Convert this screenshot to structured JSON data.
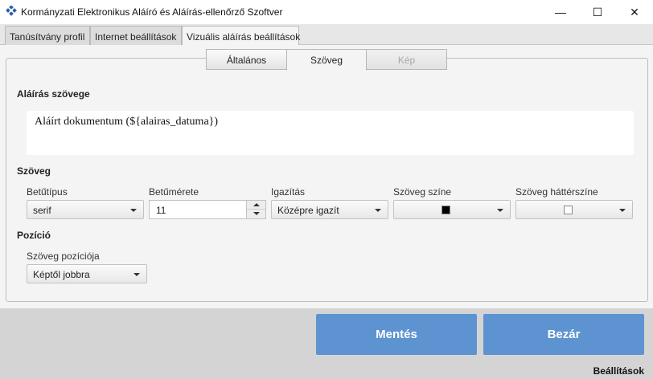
{
  "window": {
    "title": "Kormányzati Elektronikus Aláíró és Aláírás-ellenőrző Szoftver",
    "minimize": "—",
    "maximize": "☐",
    "close": "✕"
  },
  "tabs": [
    {
      "label": "Tanúsítvány profil",
      "active": false
    },
    {
      "label": "Internet beállítások",
      "active": false
    },
    {
      "label": "Vizuális aláírás beállítások",
      "active": true
    }
  ],
  "subtabs": [
    {
      "label": "Általános",
      "state": "normal"
    },
    {
      "label": "Szöveg",
      "state": "active"
    },
    {
      "label": "Kép",
      "state": "disabled"
    }
  ],
  "signature_text": {
    "heading": "Aláírás szövege",
    "value": "Aláírt dokumentum (${alairas_datuma})"
  },
  "text_section": {
    "heading": "Szöveg",
    "font_label": "Betűtípus",
    "font_value": "serif",
    "size_label": "Betűmérete",
    "size_value": "11",
    "align_label": "Igazítás",
    "align_value": "Középre igazít",
    "color_label": "Szöveg színe",
    "color_value": "#000000",
    "bg_label": "Szöveg háttérszíne",
    "bg_value": "#ffffff"
  },
  "position_section": {
    "heading": "Pozíció",
    "pos_label": "Szöveg pozíciója",
    "pos_value": "Képtől jobbra"
  },
  "buttons": {
    "save": "Mentés",
    "close": "Bezár"
  },
  "status": "Beállítások",
  "colors": {
    "accent": "#5d93d1",
    "background": "#f4f4f4"
  }
}
